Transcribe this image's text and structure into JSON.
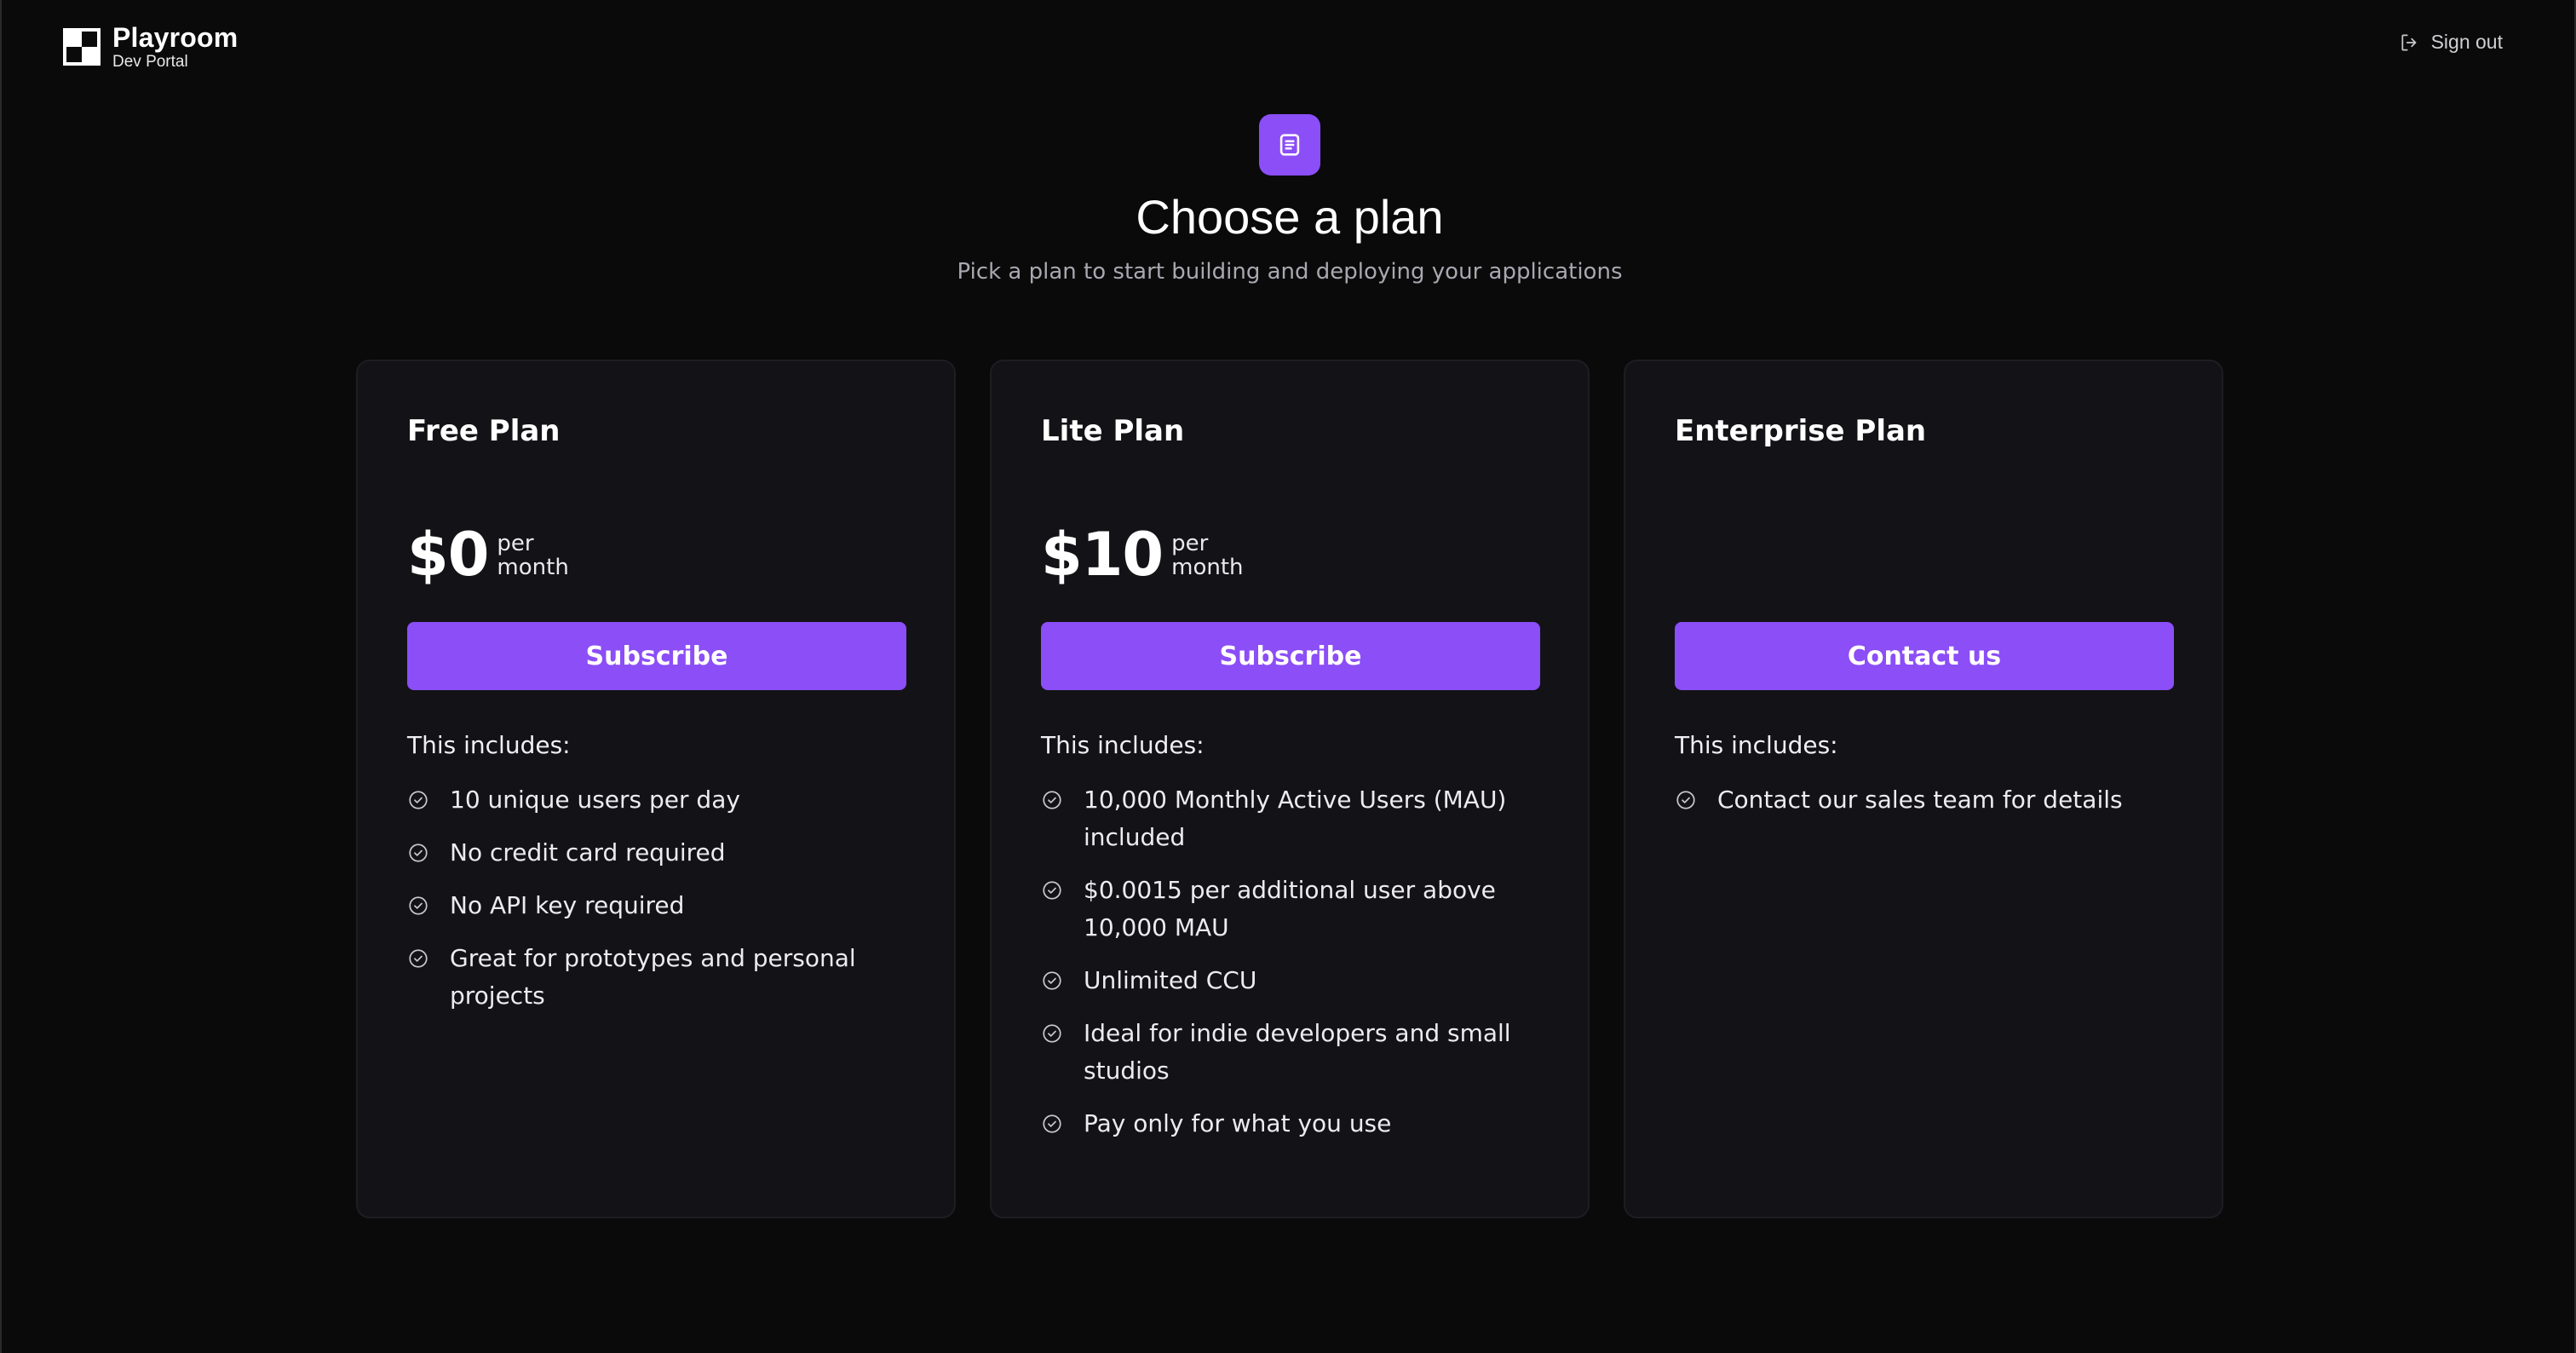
{
  "header": {
    "brand_name": "Playroom",
    "brand_sub": "Dev Portal",
    "signout_label": "Sign out"
  },
  "hero": {
    "title": "Choose a plan",
    "subtitle": "Pick a plan to start building and deploying your applications",
    "icon": "document-list-icon"
  },
  "colors": {
    "accent": "#8b4ef7",
    "background": "#0a0a0b",
    "card": "#131317"
  },
  "plans": [
    {
      "name": "Free Plan",
      "price": "$0",
      "per_line1": "per",
      "per_line2": "month",
      "cta": "Subscribe",
      "includes_label": "This includes:",
      "features": [
        "10 unique users per day",
        "No credit card required",
        "No API key required",
        "Great for prototypes and personal projects"
      ]
    },
    {
      "name": "Lite Plan",
      "price": "$10",
      "per_line1": "per",
      "per_line2": "month",
      "cta": "Subscribe",
      "includes_label": "This includes:",
      "features": [
        "10,000 Monthly Active Users (MAU) included",
        "$0.0015 per additional user above 10,000 MAU",
        "Unlimited CCU",
        "Ideal for indie developers and small studios",
        "Pay only for what you use"
      ]
    },
    {
      "name": "Enterprise Plan",
      "cta": "Contact us",
      "includes_label": "This includes:",
      "features": [
        "Contact our sales team for details"
      ]
    }
  ]
}
